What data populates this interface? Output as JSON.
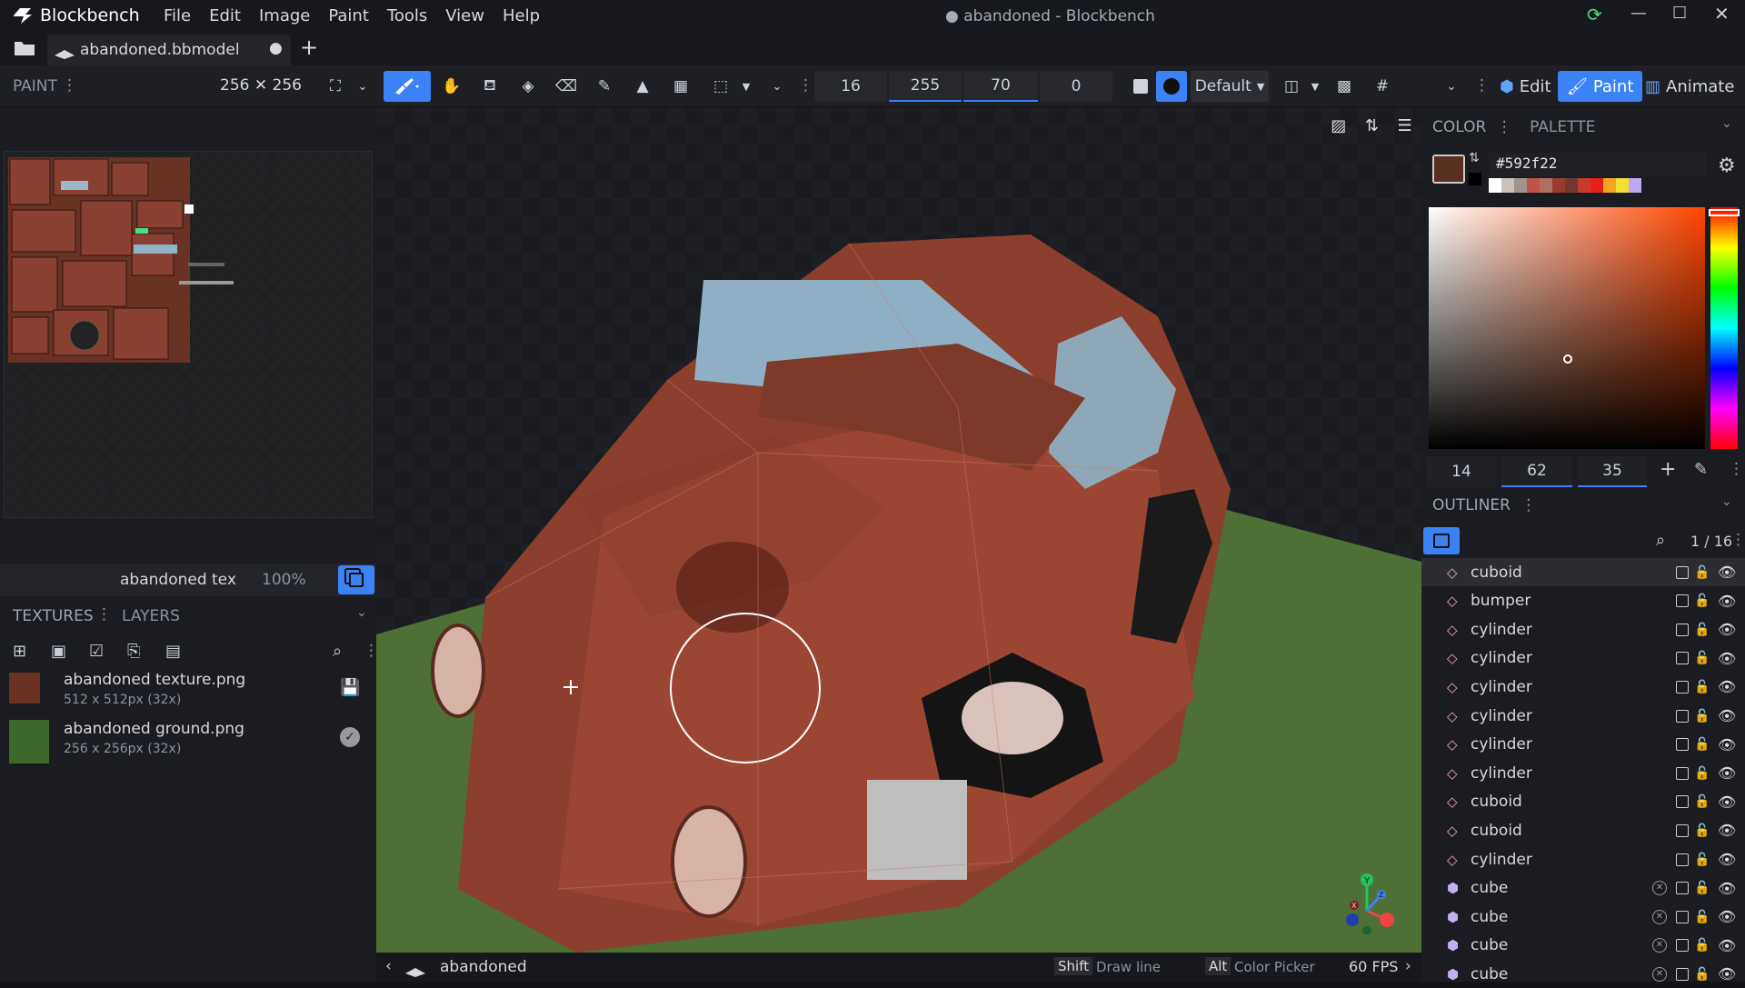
{
  "app": {
    "name": "Blockbench",
    "window_title": "● abandoned - Blockbench"
  },
  "menu": [
    "File",
    "Edit",
    "Image",
    "Paint",
    "Tools",
    "View",
    "Help"
  ],
  "tab": {
    "name": "abandoned.bbmodel",
    "modified": "●",
    "add": "+"
  },
  "toolbar": {
    "mode_label": "PAINT",
    "canvas_size": "256 ✕ 256",
    "brush_size": "16",
    "opacity": "255",
    "softness": "70",
    "extra": "0",
    "blend_mode": "Default"
  },
  "modes": {
    "edit": "Edit",
    "paint": "Paint",
    "animate": "Animate"
  },
  "texture_info": {
    "name": "abandoned tex",
    "zoom": "100%"
  },
  "panels": {
    "textures": "TEXTURES",
    "layers": "LAYERS",
    "color": "COLOR",
    "palette": "PALETTE",
    "outliner": "OUTLINER"
  },
  "textures": [
    {
      "name": "abandoned texture.png",
      "info": "512 x 512px (32x)"
    },
    {
      "name": "abandoned ground.png",
      "info": "256 x 256px (32x)"
    }
  ],
  "color": {
    "hex": "#592f22",
    "h": "14",
    "s": "62",
    "v": "35",
    "current": "#592f22",
    "swatches": [
      "#ffffff",
      "#c9c2bd",
      "#a0948c",
      "#c0544a",
      "#b07060",
      "#9b3b2e",
      "#6e3a2e",
      "#c93a2c",
      "#e8201a",
      "#f4a520",
      "#f0e030",
      "#c0a8f0"
    ]
  },
  "outliner": {
    "count": "1 / 16",
    "items": [
      {
        "name": "cuboid",
        "type": "mesh"
      },
      {
        "name": "bumper",
        "type": "mesh"
      },
      {
        "name": "cylinder",
        "type": "mesh"
      },
      {
        "name": "cylinder",
        "type": "mesh"
      },
      {
        "name": "cylinder",
        "type": "mesh"
      },
      {
        "name": "cylinder",
        "type": "mesh"
      },
      {
        "name": "cylinder",
        "type": "mesh"
      },
      {
        "name": "cylinder",
        "type": "mesh"
      },
      {
        "name": "cuboid",
        "type": "mesh"
      },
      {
        "name": "cuboid",
        "type": "mesh"
      },
      {
        "name": "cylinder",
        "type": "mesh"
      },
      {
        "name": "cube",
        "type": "cube"
      },
      {
        "name": "cube",
        "type": "cube"
      },
      {
        "name": "cube",
        "type": "cube"
      },
      {
        "name": "cube",
        "type": "cube"
      }
    ]
  },
  "status": {
    "model": "abandoned",
    "shift_key": "Shift",
    "shift_action": "Draw line",
    "alt_key": "Alt",
    "alt_action": "Color Picker",
    "fps": "60 FPS"
  },
  "gizmo": {
    "y": "Y",
    "z": "Z",
    "x": "X"
  }
}
